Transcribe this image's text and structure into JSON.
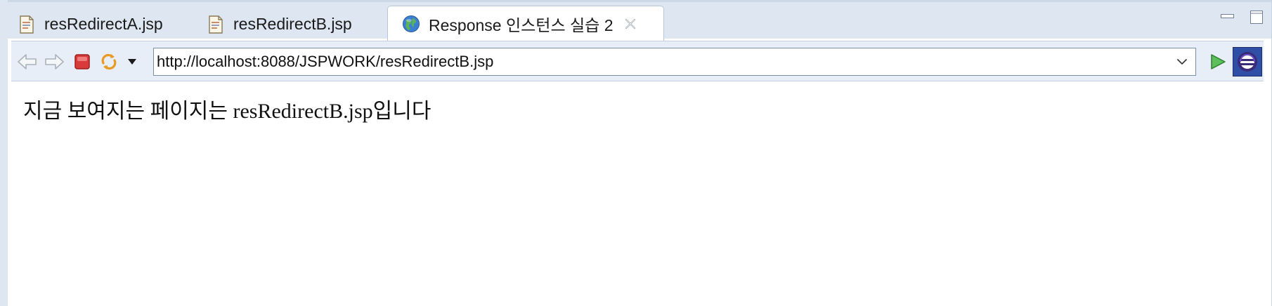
{
  "tabs": [
    {
      "label": "resRedirectA.jsp",
      "icon": "jsp-file-icon"
    },
    {
      "label": "resRedirectB.jsp",
      "icon": "jsp-file-icon"
    },
    {
      "label": "Response 인스턴스 실습 2",
      "icon": "globe-icon",
      "active": true
    }
  ],
  "toolbar": {
    "url": "http://localhost:8088/JSPWORK/resRedirectB.jsp"
  },
  "page": {
    "text": "지금 보여지는 페이지는 resRedirectB.jsp입니다"
  },
  "colors": {
    "chrome_bg": "#dde6f1",
    "toolbar_bg": "#e7eef7",
    "stop_red": "#d93a3a",
    "go_green": "#3fa63f"
  }
}
